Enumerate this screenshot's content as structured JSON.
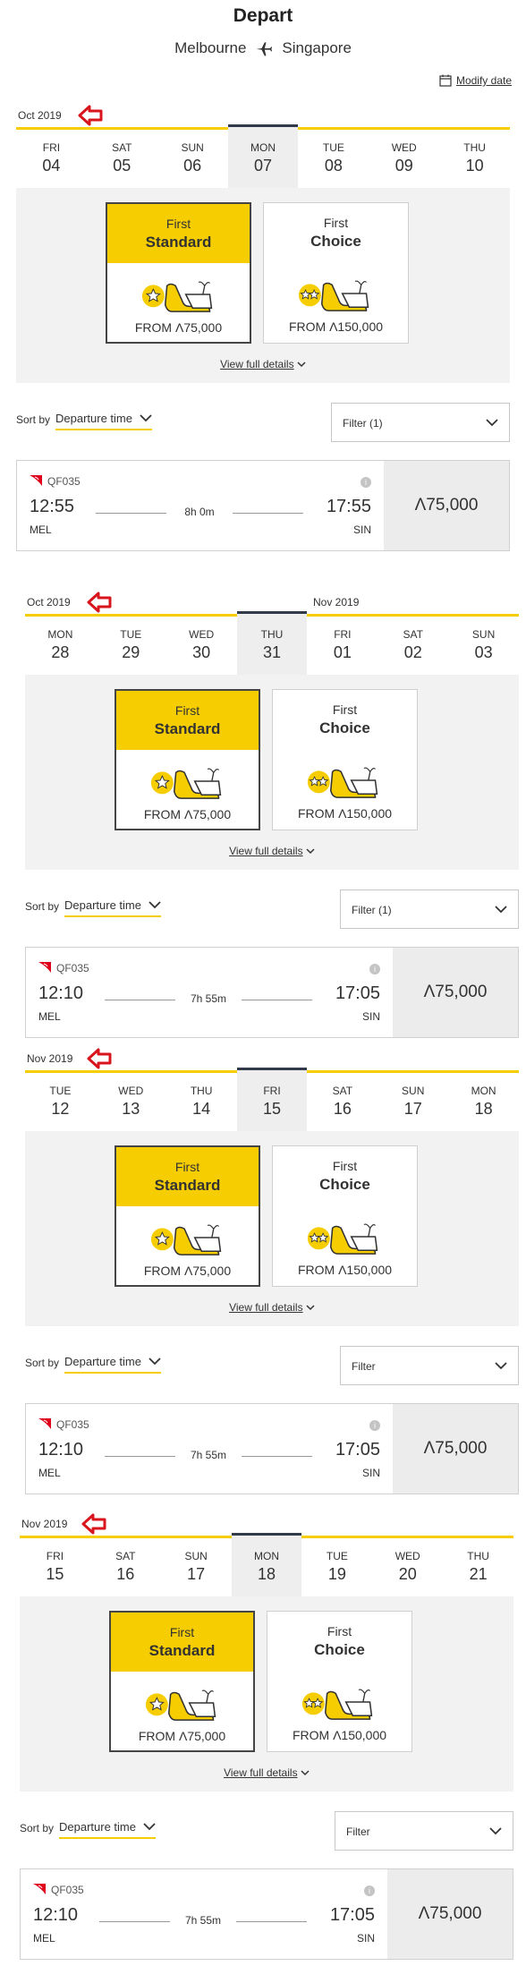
{
  "header": {
    "title": "Depart",
    "origin": "Melbourne",
    "destination": "Singapore",
    "modify_label": "Modify date"
  },
  "colors": {
    "accent": "#f5cd00",
    "selected_bar": "#323a4a",
    "panel": "#f2f2f2"
  },
  "blocks": [
    {
      "months": [
        {
          "label": "Oct 2019"
        }
      ],
      "days": [
        {
          "dn": "FRI",
          "dd": "04"
        },
        {
          "dn": "SAT",
          "dd": "05"
        },
        {
          "dn": "SUN",
          "dd": "06"
        },
        {
          "dn": "MON",
          "dd": "07"
        },
        {
          "dn": "TUE",
          "dd": "08"
        },
        {
          "dn": "WED",
          "dd": "09"
        },
        {
          "dn": "THU",
          "dd": "10"
        }
      ],
      "selected_index": 3,
      "fares": [
        {
          "cabin": "First",
          "name": "Standard",
          "from": "FROM",
          "roo": "Λ",
          "points": "75,000",
          "stars": 1
        },
        {
          "cabin": "First",
          "name": "Choice",
          "from": "FROM",
          "roo": "Λ",
          "points": "150,000",
          "stars": 2
        }
      ],
      "view_details": "View full details",
      "sort_label": "Sort by",
      "sort_value": "Departure time",
      "filter_label": "Filter (1)",
      "flight": {
        "number": "QF035",
        "dep_time": "12:55",
        "arr_time": "17:55",
        "duration": "8h 0m",
        "dep_airport": "MEL",
        "arr_airport": "SIN",
        "roo": "Λ",
        "price": "75,000"
      }
    },
    {
      "months": [
        {
          "label": "Oct 2019"
        },
        {
          "label": "Nov 2019"
        }
      ],
      "days": [
        {
          "dn": "MON",
          "dd": "28"
        },
        {
          "dn": "TUE",
          "dd": "29"
        },
        {
          "dn": "WED",
          "dd": "30"
        },
        {
          "dn": "THU",
          "dd": "31"
        },
        {
          "dn": "FRI",
          "dd": "01"
        },
        {
          "dn": "SAT",
          "dd": "02"
        },
        {
          "dn": "SUN",
          "dd": "03"
        }
      ],
      "selected_index": 3,
      "fares": [
        {
          "cabin": "First",
          "name": "Standard",
          "from": "FROM",
          "roo": "Λ",
          "points": "75,000",
          "stars": 1
        },
        {
          "cabin": "First",
          "name": "Choice",
          "from": "FROM",
          "roo": "Λ",
          "points": "150,000",
          "stars": 2
        }
      ],
      "view_details": "View full details",
      "sort_label": "Sort by",
      "sort_value": "Departure time",
      "filter_label": "Filter (1)",
      "flight": {
        "number": "QF035",
        "dep_time": "12:10",
        "arr_time": "17:05",
        "duration": "7h 55m",
        "dep_airport": "MEL",
        "arr_airport": "SIN",
        "roo": "Λ",
        "price": "75,000"
      }
    },
    {
      "months": [
        {
          "label": "Nov 2019"
        }
      ],
      "days": [
        {
          "dn": "TUE",
          "dd": "12"
        },
        {
          "dn": "WED",
          "dd": "13"
        },
        {
          "dn": "THU",
          "dd": "14"
        },
        {
          "dn": "FRI",
          "dd": "15"
        },
        {
          "dn": "SAT",
          "dd": "16"
        },
        {
          "dn": "SUN",
          "dd": "17"
        },
        {
          "dn": "MON",
          "dd": "18"
        }
      ],
      "selected_index": 3,
      "fares": [
        {
          "cabin": "First",
          "name": "Standard",
          "from": "FROM",
          "roo": "Λ",
          "points": "75,000",
          "stars": 1
        },
        {
          "cabin": "First",
          "name": "Choice",
          "from": "FROM",
          "roo": "Λ",
          "points": "150,000",
          "stars": 2
        }
      ],
      "view_details": "View full details",
      "sort_label": "Sort by",
      "sort_value": "Departure time",
      "filter_label": "Filter",
      "flight": {
        "number": "QF035",
        "dep_time": "12:10",
        "arr_time": "17:05",
        "duration": "7h 55m",
        "dep_airport": "MEL",
        "arr_airport": "SIN",
        "roo": "Λ",
        "price": "75,000"
      }
    },
    {
      "months": [
        {
          "label": "Nov 2019"
        }
      ],
      "days": [
        {
          "dn": "FRI",
          "dd": "15"
        },
        {
          "dn": "SAT",
          "dd": "16"
        },
        {
          "dn": "SUN",
          "dd": "17"
        },
        {
          "dn": "MON",
          "dd": "18"
        },
        {
          "dn": "TUE",
          "dd": "19"
        },
        {
          "dn": "WED",
          "dd": "20"
        },
        {
          "dn": "THU",
          "dd": "21"
        }
      ],
      "selected_index": 3,
      "fares": [
        {
          "cabin": "First",
          "name": "Standard",
          "from": "FROM",
          "roo": "Λ",
          "points": "75,000",
          "stars": 1
        },
        {
          "cabin": "First",
          "name": "Choice",
          "from": "FROM",
          "roo": "Λ",
          "points": "150,000",
          "stars": 2
        }
      ],
      "view_details": "View full details",
      "sort_label": "Sort by",
      "sort_value": "Departure time",
      "filter_label": "Filter",
      "flight": {
        "number": "QF035",
        "dep_time": "12:10",
        "arr_time": "17:05",
        "duration": "7h 55m",
        "dep_airport": "MEL",
        "arr_airport": "SIN",
        "roo": "Λ",
        "price": "75,000"
      }
    }
  ]
}
